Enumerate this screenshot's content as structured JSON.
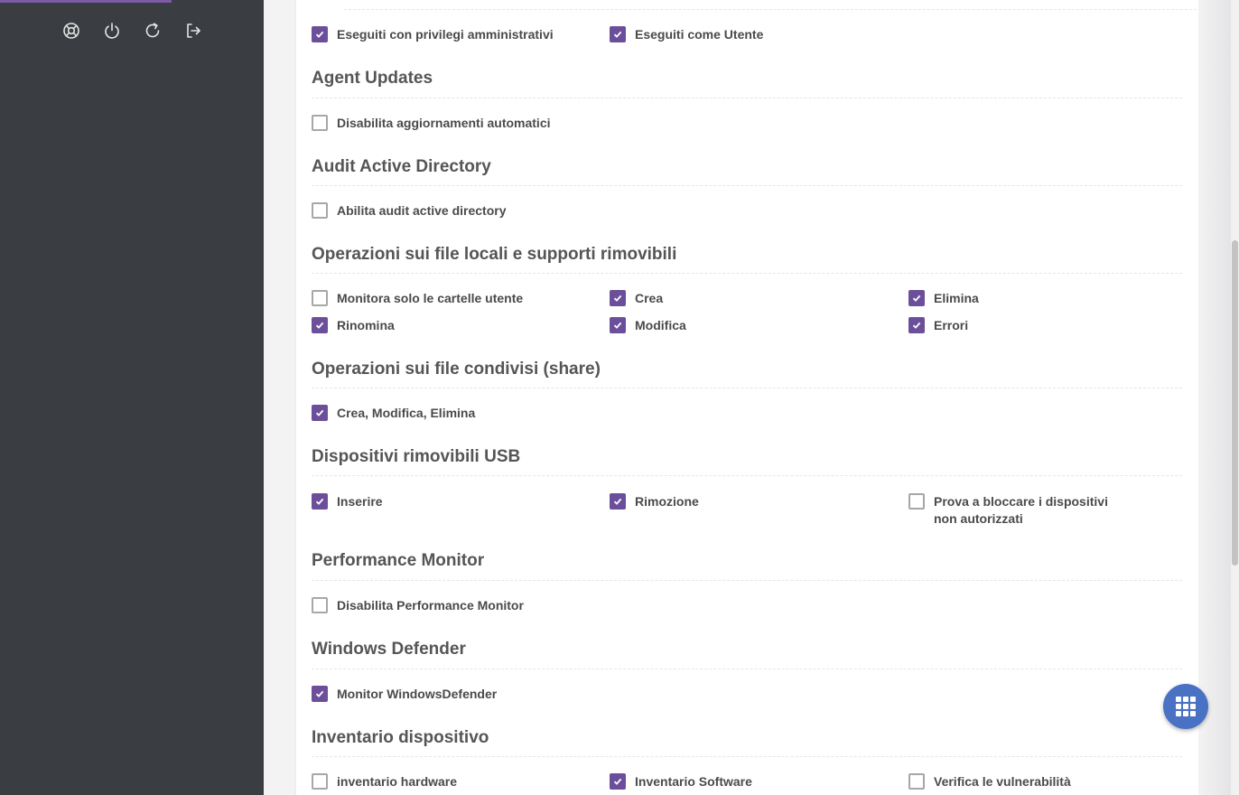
{
  "colors": {
    "accent": "#6c4f9b",
    "sidebar_bg": "#3a3d42",
    "fab_bg": "#4a72c4"
  },
  "sidebar": {
    "icons": [
      "lifebuoy-icon",
      "power-icon",
      "refresh-icon",
      "logout-icon"
    ]
  },
  "sections": {
    "privileges": {
      "items": [
        {
          "label": "Eseguiti con privilegi amministrativi",
          "checked": true
        },
        {
          "label": "Eseguiti come Utente",
          "checked": true
        }
      ]
    },
    "agent_updates": {
      "title": "Agent Updates",
      "items": [
        {
          "label": "Disabilita aggiornamenti automatici",
          "checked": false
        }
      ]
    },
    "audit_ad": {
      "title": "Audit Active Directory",
      "items": [
        {
          "label": "Abilita audit active directory",
          "checked": false
        }
      ]
    },
    "local_files": {
      "title": "Operazioni sui file locali e supporti rimovibili",
      "items": [
        {
          "label": "Monitora solo le cartelle utente",
          "checked": false
        },
        {
          "label": "Crea",
          "checked": true
        },
        {
          "label": "Elimina",
          "checked": true
        },
        {
          "label": "Rinomina",
          "checked": true
        },
        {
          "label": "Modifica",
          "checked": true
        },
        {
          "label": "Errori",
          "checked": true
        }
      ]
    },
    "shared_files": {
      "title": "Operazioni sui file condivisi (share)",
      "items": [
        {
          "label": "Crea, Modifica, Elimina",
          "checked": true
        }
      ]
    },
    "usb": {
      "title": "Dispositivi rimovibili USB",
      "items": [
        {
          "label": "Inserire",
          "checked": true
        },
        {
          "label": "Rimozione",
          "checked": true
        },
        {
          "label": "Prova a bloccare i dispositivi non autorizzati",
          "checked": false
        }
      ]
    },
    "perf_monitor": {
      "title": "Performance Monitor",
      "items": [
        {
          "label": "Disabilita Performance Monitor",
          "checked": false
        }
      ]
    },
    "defender": {
      "title": "Windows Defender",
      "items": [
        {
          "label": "Monitor WindowsDefender",
          "checked": true
        }
      ]
    },
    "inventory": {
      "title": "Inventario dispositivo",
      "items": [
        {
          "label": "inventario hardware",
          "checked": false
        },
        {
          "label": "Inventario Software",
          "checked": true
        },
        {
          "label": "Verifica le vulnerabilità",
          "checked": false
        }
      ]
    }
  }
}
